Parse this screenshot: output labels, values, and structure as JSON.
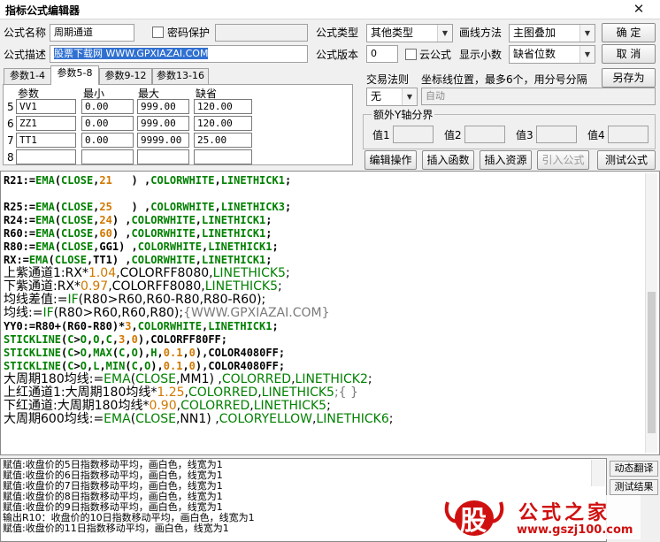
{
  "window": {
    "title": "指标公式编辑器",
    "close_glyph": "✕"
  },
  "form": {
    "name_label": "公式名称",
    "name_value": "周期通道",
    "password_label": "密码保护",
    "desc_label": "公式描述",
    "desc_value": "股票下载网 WWW.GPXIAZAI.COM",
    "type_label": "公式类型",
    "type_value": "其他类型",
    "draw_label": "画线方法",
    "draw_value": "主图叠加",
    "version_label": "公式版本",
    "version_value": "0",
    "cloud_label": "云公式",
    "decimals_label": "显示小数",
    "decimals_value": "缺省位数"
  },
  "buttons": {
    "ok": "确  定",
    "cancel": "取  消",
    "save_as": "另存为",
    "edit_ops": "编辑操作",
    "insert_func": "插入函数",
    "insert_res": "插入资源",
    "import_formula": "引入公式",
    "test_formula": "测试公式"
  },
  "tabs": [
    "参数1-4",
    "参数5-8",
    "参数9-12",
    "参数13-16"
  ],
  "params": {
    "headers": [
      "参数",
      "最小",
      "最大",
      "缺省"
    ],
    "rows": [
      {
        "idx": "5",
        "name": "VV1",
        "min": "0.00",
        "max": "999.00",
        "def": "120.00"
      },
      {
        "idx": "6",
        "name": "ZZ1",
        "min": "0.00",
        "max": "999.00",
        "def": "120.00"
      },
      {
        "idx": "7",
        "name": "TT1",
        "min": "0.00",
        "max": "9999.00",
        "def": "25.00"
      },
      {
        "idx": "8",
        "name": "",
        "min": "",
        "max": "",
        "def": ""
      }
    ]
  },
  "trade": {
    "label": "交易法则",
    "value": "无",
    "coord_label": "坐标线位置，最多6个，用分号分隔",
    "coord_placeholder": "自动"
  },
  "yaxis": {
    "title": "额外Y轴分界",
    "labels": [
      "值1",
      "值2",
      "值3",
      "值4"
    ]
  },
  "colors": {
    "keyword": "#1010cc",
    "func": "#008000",
    "number": "#d07800",
    "comment": "#7a7a7a",
    "text": "#000000"
  },
  "code_lines": [
    [
      [
        "R21:=",
        "t"
      ],
      [
        "EMA",
        "f"
      ],
      [
        "(",
        "t"
      ],
      [
        "CLOSE",
        "f"
      ],
      [
        ",",
        "t"
      ],
      [
        "21",
        "n"
      ],
      [
        "   ) ,",
        "t"
      ],
      [
        "COLORWHITE",
        "f"
      ],
      [
        ",",
        "t"
      ],
      [
        "LINETHICK1",
        "f"
      ],
      [
        ";",
        "t"
      ]
    ],
    [],
    [
      [
        "R25:=",
        "t"
      ],
      [
        "EMA",
        "f"
      ],
      [
        "(",
        "t"
      ],
      [
        "CLOSE",
        "f"
      ],
      [
        ",",
        "t"
      ],
      [
        "25",
        "n"
      ],
      [
        "   ) ,",
        "t"
      ],
      [
        "COLORWHITE",
        "f"
      ],
      [
        ",",
        "t"
      ],
      [
        "LINETHICK3",
        "f"
      ],
      [
        ";",
        "t"
      ]
    ],
    [
      [
        "R24:=",
        "t"
      ],
      [
        "EMA",
        "f"
      ],
      [
        "(",
        "t"
      ],
      [
        "CLOSE",
        "f"
      ],
      [
        ",",
        "t"
      ],
      [
        "24",
        "n"
      ],
      [
        ") ,",
        "t"
      ],
      [
        "COLORWHITE",
        "f"
      ],
      [
        ",",
        "t"
      ],
      [
        "LINETHICK1",
        "f"
      ],
      [
        ";",
        "t"
      ]
    ],
    [
      [
        "R60:=",
        "t"
      ],
      [
        "EMA",
        "f"
      ],
      [
        "(",
        "t"
      ],
      [
        "CLOSE",
        "f"
      ],
      [
        ",",
        "t"
      ],
      [
        "60",
        "n"
      ],
      [
        ") ,",
        "t"
      ],
      [
        "COLORWHITE",
        "f"
      ],
      [
        ",",
        "t"
      ],
      [
        "LINETHICK1",
        "f"
      ],
      [
        ";",
        "t"
      ]
    ],
    [
      [
        "R80:=",
        "t"
      ],
      [
        "EMA",
        "f"
      ],
      [
        "(",
        "t"
      ],
      [
        "CLOSE",
        "f"
      ],
      [
        ",GG1) ,",
        "t"
      ],
      [
        "COLORWHITE",
        "f"
      ],
      [
        ",",
        "t"
      ],
      [
        "LINETHICK1",
        "f"
      ],
      [
        ";",
        "t"
      ]
    ],
    [
      [
        "RX:=",
        "t"
      ],
      [
        "EMA",
        "f"
      ],
      [
        "(",
        "t"
      ],
      [
        "CLOSE",
        "f"
      ],
      [
        ",TT1) ,",
        "t"
      ],
      [
        "COLORWHITE",
        "f"
      ],
      [
        ",",
        "t"
      ],
      [
        "LINETHICK1",
        "f"
      ],
      [
        ";",
        "t"
      ]
    ],
    [
      [
        "上紫通道1:RX*",
        "tb"
      ],
      [
        "1.04",
        "n"
      ],
      [
        ",COLORFF8080,",
        "t"
      ],
      [
        "LINETHICK5",
        "f"
      ],
      [
        ";",
        "t"
      ]
    ],
    [
      [
        "下紫通道:RX*",
        "tb"
      ],
      [
        "0.97",
        "n"
      ],
      [
        ",COLORFF8080,",
        "t"
      ],
      [
        "LINETHICK5",
        "f"
      ],
      [
        ";",
        "t"
      ]
    ],
    [
      [
        "均线差值:=",
        "tb"
      ],
      [
        "IF",
        "f"
      ],
      [
        "(R80>R60,R60-R80,R80-R60);",
        "t"
      ]
    ],
    [
      [
        "均线:=",
        "tb"
      ],
      [
        "IF",
        "f"
      ],
      [
        "(R80>R60,R60,R80);",
        "t"
      ],
      [
        "{WWW.GPXIAZAI.COM}",
        "c"
      ]
    ],
    [
      [
        "YY0:=R80+(R60-R80)*",
        "t"
      ],
      [
        "3",
        "n"
      ],
      [
        ",",
        "t"
      ],
      [
        "COLORWHITE",
        "f"
      ],
      [
        ",",
        "t"
      ],
      [
        "LINETHICK1",
        "f"
      ],
      [
        ";",
        "t"
      ]
    ],
    [
      [
        "STICKLINE",
        "f"
      ],
      [
        "(",
        "t"
      ],
      [
        "C",
        "f"
      ],
      [
        ">",
        "t"
      ],
      [
        "O",
        "f"
      ],
      [
        ",",
        "t"
      ],
      [
        "O",
        "f"
      ],
      [
        ",",
        "t"
      ],
      [
        "C",
        "f"
      ],
      [
        ",",
        "t"
      ],
      [
        "3",
        "n"
      ],
      [
        ",",
        "t"
      ],
      [
        "0",
        "n"
      ],
      [
        "),COLORFF80FF;",
        "t"
      ]
    ],
    [
      [
        "STICKLINE",
        "f"
      ],
      [
        "(",
        "t"
      ],
      [
        "C",
        "f"
      ],
      [
        ">",
        "t"
      ],
      [
        "O",
        "f"
      ],
      [
        ",",
        "t"
      ],
      [
        "MAX",
        "f"
      ],
      [
        "(",
        "t"
      ],
      [
        "C",
        "f"
      ],
      [
        ",",
        "t"
      ],
      [
        "O",
        "f"
      ],
      [
        "),",
        "t"
      ],
      [
        "H",
        "f"
      ],
      [
        ",",
        "t"
      ],
      [
        "0.1",
        "n"
      ],
      [
        ",",
        "t"
      ],
      [
        "0",
        "n"
      ],
      [
        "),COLOR4080FF;",
        "t"
      ]
    ],
    [
      [
        "STICKLINE",
        "f"
      ],
      [
        "(",
        "t"
      ],
      [
        "C",
        "f"
      ],
      [
        ">",
        "t"
      ],
      [
        "O",
        "f"
      ],
      [
        ",",
        "t"
      ],
      [
        "L",
        "f"
      ],
      [
        ",",
        "t"
      ],
      [
        "MIN",
        "f"
      ],
      [
        "(",
        "t"
      ],
      [
        "C",
        "f"
      ],
      [
        ",",
        "t"
      ],
      [
        "O",
        "f"
      ],
      [
        "),",
        "t"
      ],
      [
        "0.1",
        "n"
      ],
      [
        ",",
        "t"
      ],
      [
        "0",
        "n"
      ],
      [
        "),COLOR4080FF;",
        "t"
      ]
    ],
    [
      [
        "大周期180均线:=",
        "tb"
      ],
      [
        "EMA",
        "f"
      ],
      [
        "(",
        "t"
      ],
      [
        "CLOSE",
        "f"
      ],
      [
        ",MM1) ,",
        "t"
      ],
      [
        "COLORRED",
        "f"
      ],
      [
        ",",
        "t"
      ],
      [
        "LINETHICK2",
        "f"
      ],
      [
        ";",
        "t"
      ]
    ],
    [
      [
        "上红通道1:大周期180均线*",
        "tb"
      ],
      [
        "1.25",
        "n"
      ],
      [
        ",",
        "t"
      ],
      [
        "COLORRED",
        "f"
      ],
      [
        ",",
        "t"
      ],
      [
        "LINETHICK5",
        "f"
      ],
      [
        ";{ }",
        "c"
      ]
    ],
    [
      [
        "下红通道:大周期180均线*",
        "tb"
      ],
      [
        "0.90",
        "n"
      ],
      [
        ",",
        "t"
      ],
      [
        "COLORRED",
        "f"
      ],
      [
        ",",
        "t"
      ],
      [
        "LINETHICK5",
        "f"
      ],
      [
        ";",
        "t"
      ]
    ],
    [
      [
        "大周期600均线:=",
        "tb"
      ],
      [
        "EMA",
        "f"
      ],
      [
        "(",
        "t"
      ],
      [
        "CLOSE",
        "f"
      ],
      [
        ",NN1) ,",
        "t"
      ],
      [
        "COLORYELLOW",
        "f"
      ],
      [
        ",",
        "t"
      ],
      [
        "LINETHICK6",
        "f"
      ],
      [
        ";",
        "t"
      ]
    ]
  ],
  "output_lines": [
    "赋值:收盘价的5日指数移动平均，画白色，线宽为1",
    "赋值:收盘价的6日指数移动平均，画白色，线宽为1",
    "赋值:收盘价的7日指数移动平均，画白色，线宽为1",
    "赋值:收盘价的8日指数移动平均，画白色，线宽为1",
    "赋值:收盘价的9日指数移动平均，画白色，线宽为1",
    "输出R10：收盘价的10日指数移动平均，画白色，线宽为1",
    "赋值:收盘价的11日指数移动平均，画白色，线宽为1"
  ],
  "side_buttons": [
    "动态翻译",
    "测试结果"
  ],
  "watermark": {
    "logo_char": "股",
    "name": "公式之家",
    "url": "www.gszj100.com"
  }
}
